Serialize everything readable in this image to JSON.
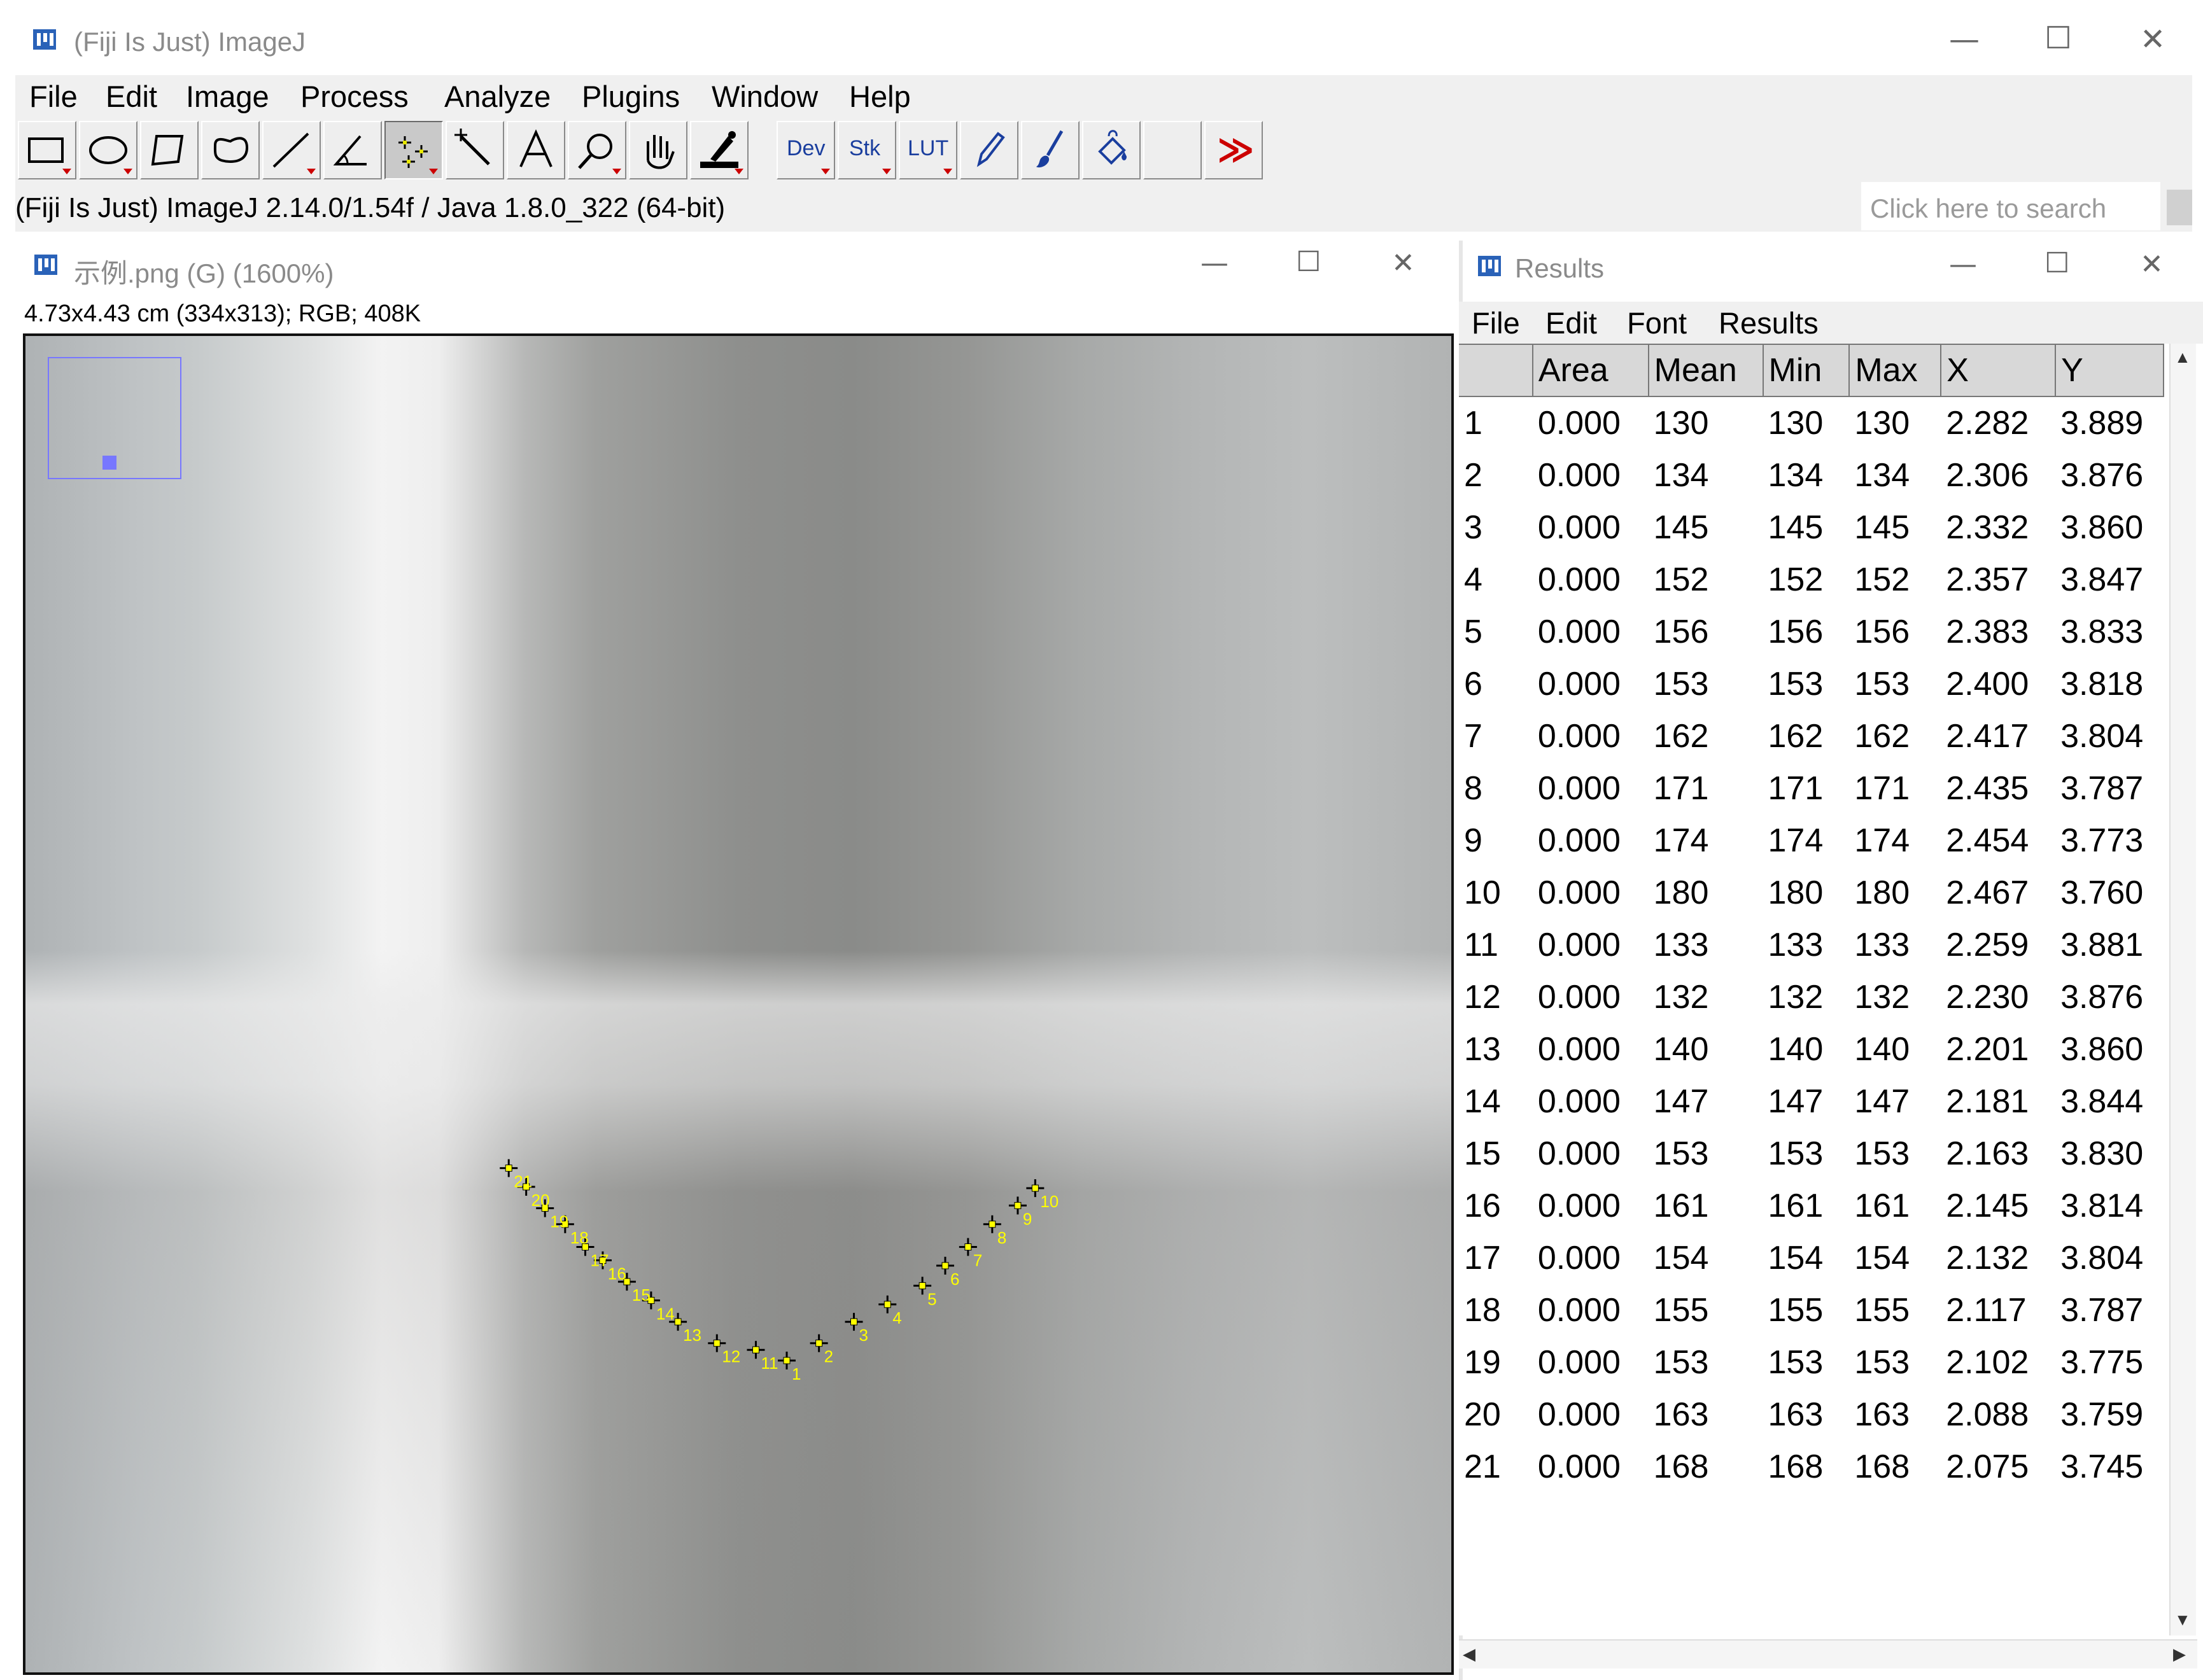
{
  "main_window": {
    "title": "(Fiji Is Just) ImageJ",
    "controls": {
      "minimize": "—",
      "maximize": "☐",
      "close": "✕"
    },
    "menu": [
      "File",
      "Edit",
      "Image",
      "Process",
      "Analyze",
      "Plugins",
      "Window",
      "Help"
    ],
    "toolbar": {
      "tools": [
        {
          "name": "rectangle-tool",
          "selected": false
        },
        {
          "name": "oval-tool",
          "selected": false
        },
        {
          "name": "polygon-tool",
          "selected": false
        },
        {
          "name": "freehand-tool",
          "selected": false
        },
        {
          "name": "line-tool",
          "selected": false
        },
        {
          "name": "angle-tool",
          "selected": false
        },
        {
          "name": "multipoint-tool",
          "selected": true
        },
        {
          "name": "wand-tool",
          "selected": false
        },
        {
          "name": "text-tool",
          "selected": false
        },
        {
          "name": "magnifier-tool",
          "selected": false
        },
        {
          "name": "hand-tool",
          "selected": false
        },
        {
          "name": "dropper-tool",
          "selected": false
        }
      ],
      "dev_label": "Dev",
      "stk_label": "Stk",
      "lut_label": "LUT",
      "more_tools_glyph": "≫"
    },
    "status": "(Fiji Is Just) ImageJ 2.14.0/1.54f / Java 1.8.0_322 (64-bit)",
    "search_placeholder": "Click here to search",
    "accent": "#cc0000"
  },
  "image_window": {
    "title": "示例.png (G) (1600%)",
    "info": "4.73x4.43 cm (334x313); RGB; 408K",
    "point_color": "#ffff00",
    "points": [
      {
        "label": "1",
        "x": 2.282,
        "y": 3.889
      },
      {
        "label": "2",
        "x": 2.306,
        "y": 3.876
      },
      {
        "label": "3",
        "x": 2.332,
        "y": 3.86
      },
      {
        "label": "4",
        "x": 2.357,
        "y": 3.847
      },
      {
        "label": "5",
        "x": 2.383,
        "y": 3.833
      },
      {
        "label": "6",
        "x": 2.4,
        "y": 3.818
      },
      {
        "label": "7",
        "x": 2.417,
        "y": 3.804
      },
      {
        "label": "8",
        "x": 2.435,
        "y": 3.787
      },
      {
        "label": "9",
        "x": 2.454,
        "y": 3.773
      },
      {
        "label": "10",
        "x": 2.467,
        "y": 3.76
      },
      {
        "label": "11",
        "x": 2.259,
        "y": 3.881
      },
      {
        "label": "12",
        "x": 2.23,
        "y": 3.876
      },
      {
        "label": "13",
        "x": 2.201,
        "y": 3.86
      },
      {
        "label": "14",
        "x": 2.181,
        "y": 3.844
      },
      {
        "label": "15",
        "x": 2.163,
        "y": 3.83
      },
      {
        "label": "16",
        "x": 2.145,
        "y": 3.814
      },
      {
        "label": "17",
        "x": 2.132,
        "y": 3.804
      },
      {
        "label": "18",
        "x": 2.117,
        "y": 3.787
      },
      {
        "label": "19",
        "x": 2.102,
        "y": 3.775
      },
      {
        "label": "20",
        "x": 2.088,
        "y": 3.759
      },
      {
        "label": "21",
        "x": 2.075,
        "y": 3.745
      }
    ]
  },
  "results_window": {
    "title": "Results",
    "menu": [
      "File",
      "Edit",
      "Font",
      "Results"
    ],
    "columns": [
      "",
      "Area",
      "Mean",
      "Min",
      "Max",
      "X",
      "Y"
    ],
    "rows": [
      [
        "1",
        "0.000",
        "130",
        "130",
        "130",
        "2.282",
        "3.889"
      ],
      [
        "2",
        "0.000",
        "134",
        "134",
        "134",
        "2.306",
        "3.876"
      ],
      [
        "3",
        "0.000",
        "145",
        "145",
        "145",
        "2.332",
        "3.860"
      ],
      [
        "4",
        "0.000",
        "152",
        "152",
        "152",
        "2.357",
        "3.847"
      ],
      [
        "5",
        "0.000",
        "156",
        "156",
        "156",
        "2.383",
        "3.833"
      ],
      [
        "6",
        "0.000",
        "153",
        "153",
        "153",
        "2.400",
        "3.818"
      ],
      [
        "7",
        "0.000",
        "162",
        "162",
        "162",
        "2.417",
        "3.804"
      ],
      [
        "8",
        "0.000",
        "171",
        "171",
        "171",
        "2.435",
        "3.787"
      ],
      [
        "9",
        "0.000",
        "174",
        "174",
        "174",
        "2.454",
        "3.773"
      ],
      [
        "10",
        "0.000",
        "180",
        "180",
        "180",
        "2.467",
        "3.760"
      ],
      [
        "11",
        "0.000",
        "133",
        "133",
        "133",
        "2.259",
        "3.881"
      ],
      [
        "12",
        "0.000",
        "132",
        "132",
        "132",
        "2.230",
        "3.876"
      ],
      [
        "13",
        "0.000",
        "140",
        "140",
        "140",
        "2.201",
        "3.860"
      ],
      [
        "14",
        "0.000",
        "147",
        "147",
        "147",
        "2.181",
        "3.844"
      ],
      [
        "15",
        "0.000",
        "153",
        "153",
        "153",
        "2.163",
        "3.830"
      ],
      [
        "16",
        "0.000",
        "161",
        "161",
        "161",
        "2.145",
        "3.814"
      ],
      [
        "17",
        "0.000",
        "154",
        "154",
        "154",
        "2.132",
        "3.804"
      ],
      [
        "18",
        "0.000",
        "155",
        "155",
        "155",
        "2.117",
        "3.787"
      ],
      [
        "19",
        "0.000",
        "153",
        "153",
        "153",
        "2.102",
        "3.775"
      ],
      [
        "20",
        "0.000",
        "163",
        "163",
        "163",
        "2.088",
        "3.759"
      ],
      [
        "21",
        "0.000",
        "168",
        "168",
        "168",
        "2.075",
        "3.745"
      ]
    ]
  }
}
